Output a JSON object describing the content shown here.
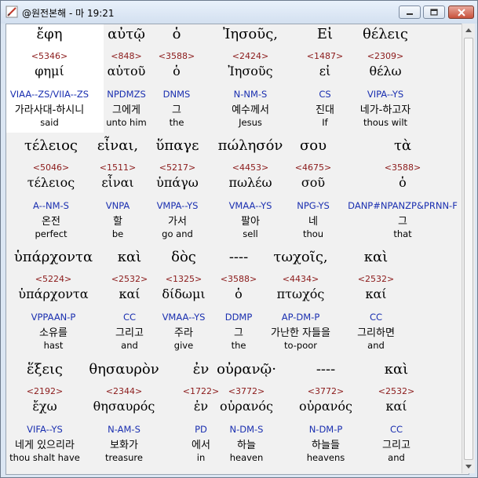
{
  "window": {
    "title": "@원전본해 - 마 19:21"
  },
  "verses": [
    {
      "words": [
        {
          "greek": "ἔφη",
          "strong": "<5346>",
          "lemma": "φημί",
          "parse": "VIAA--ZS/VIIA--ZS",
          "korean": "가라사대-하시니",
          "english": "said"
        },
        {
          "greek": "αὐτῷ",
          "strong": "<848>",
          "lemma": "αὐτοῦ",
          "parse": "NPDMZS",
          "korean": "그에게",
          "english": "unto him"
        },
        {
          "greek": "ὁ",
          "strong": "<3588>",
          "lemma": "ὁ",
          "parse": "DNMS",
          "korean": "그",
          "english": "the"
        },
        {
          "greek": "Ἰησοῦς,",
          "strong": "<2424>",
          "lemma": "Ἰησοῦς",
          "parse": "N-NM-S",
          "korean": "예수께서",
          "english": "Jesus"
        },
        {
          "greek": "Εἰ",
          "strong": "<1487>",
          "lemma": "εἰ",
          "parse": "CS",
          "korean": "진대",
          "english": "If"
        },
        {
          "greek": "θέλεις",
          "strong": "<2309>",
          "lemma": "θέλω",
          "parse": "VIPA--YS",
          "korean": "네가-하고자",
          "english": "thous wilt"
        }
      ]
    },
    {
      "words": [
        {
          "greek": "τέλειος",
          "strong": "<5046>",
          "lemma": "τέλειος",
          "parse": "A--NM-S",
          "korean": "온전",
          "english": "perfect"
        },
        {
          "greek": "εἶναι,",
          "strong": "<1511>",
          "lemma": "εἶναι",
          "parse": "VNPA",
          "korean": "할",
          "english": "be"
        },
        {
          "greek": "ὕπαγε",
          "strong": "<5217>",
          "lemma": "ὑπάγω",
          "parse": "VMPA--YS",
          "korean": "가서",
          "english": "go and"
        },
        {
          "greek": "πώλησόν",
          "strong": "<4453>",
          "lemma": "πωλέω",
          "parse": "VMAA--YS",
          "korean": "팔아",
          "english": "sell"
        },
        {
          "greek": "σου",
          "strong": "<4675>",
          "lemma": "σοῦ",
          "parse": "NPG-YS",
          "korean": "네",
          "english": "thou"
        },
        {
          "greek": "τὰ",
          "strong": "<3588>",
          "lemma": "ὁ",
          "parse": "DANP#NPANZP&PRNN-F",
          "korean": "그",
          "english": "that"
        }
      ]
    },
    {
      "words": [
        {
          "greek": "ὑπάρχοντα",
          "strong": "<5224>",
          "lemma": "ὑπάρχοντα",
          "parse": "VPPAAN-P",
          "korean": "소유를",
          "english": "hast"
        },
        {
          "greek": "καὶ",
          "strong": "<2532>",
          "lemma": "καί",
          "parse": "CC",
          "korean": "그리고",
          "english": "and"
        },
        {
          "greek": "δὸς",
          "strong": "<1325>",
          "lemma": "δίδωμι",
          "parse": "VMAA--YS",
          "korean": "주라",
          "english": "give"
        },
        {
          "greek": "----",
          "strong": "<3588>",
          "lemma": "ὁ",
          "parse": "DDMP",
          "korean": "그",
          "english": "the"
        },
        {
          "greek": "τωχοῖς,",
          "strong": "<4434>",
          "lemma": "πτωχός",
          "parse": "AP-DM-P",
          "korean": "가난한 자들을",
          "english": "to-poor"
        },
        {
          "greek": "καὶ",
          "strong": "<2532>",
          "lemma": "καί",
          "parse": "CC",
          "korean": "그리하면",
          "english": "and"
        }
      ]
    },
    {
      "words": [
        {
          "greek": "ἕξεις",
          "strong": "<2192>",
          "lemma": "ἔχω",
          "parse": "VIFA--YS",
          "korean": "네게 있으리라",
          "english": "thou shalt have"
        },
        {
          "greek": "θησαυρὸν",
          "strong": "<2344>",
          "lemma": "θησαυρός",
          "parse": "N-AM-S",
          "korean": "보화가",
          "english": "treasure"
        },
        {
          "greek": "ἐν",
          "strong": "<1722>",
          "lemma": "ἐν",
          "parse": "PD",
          "korean": "에서",
          "english": "in"
        },
        {
          "greek": "οὐρανῷ·",
          "strong": "<3772>",
          "lemma": "οὐρανός",
          "parse": "N-DM-S",
          "korean": "하늘",
          "english": "heaven"
        },
        {
          "greek": "----",
          "strong": "<3772>",
          "lemma": "οὐρανός",
          "parse": "N-DM-P",
          "korean": "하늘들",
          "english": "heavens"
        },
        {
          "greek": "καὶ",
          "strong": "<2532>",
          "lemma": "καί",
          "parse": "CC",
          "korean": "그리고",
          "english": "and"
        }
      ]
    }
  ]
}
